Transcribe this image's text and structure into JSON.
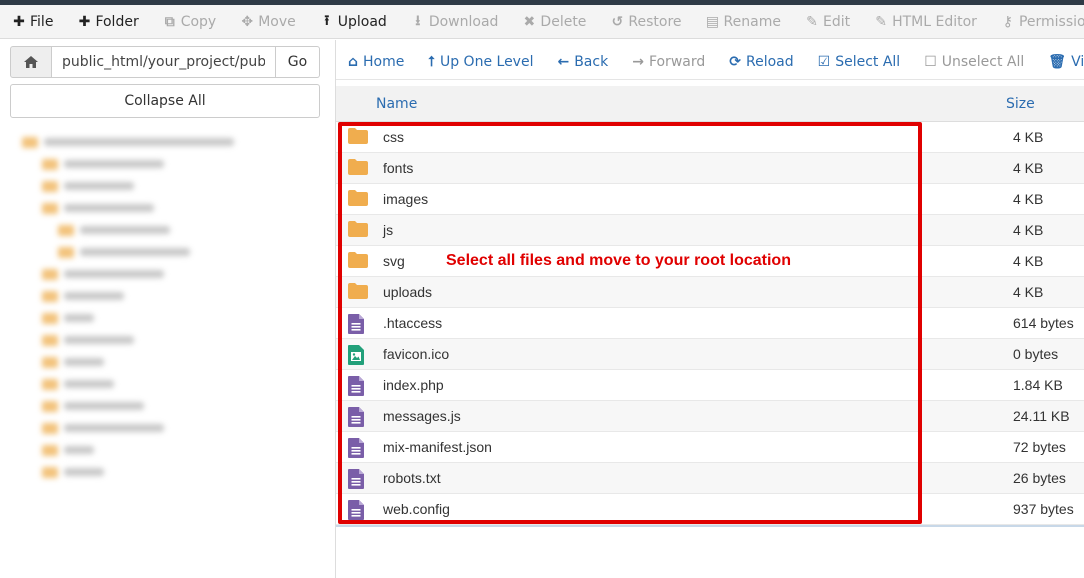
{
  "toolbar": {
    "items": [
      {
        "icon": "plus-icon",
        "glyph": "✚",
        "label": "File",
        "active": true
      },
      {
        "icon": "plus-icon",
        "glyph": "✚",
        "label": "Folder",
        "active": true
      },
      {
        "icon": "copy-icon",
        "glyph": "⧉",
        "label": "Copy",
        "active": false
      },
      {
        "icon": "move-icon",
        "glyph": "✥",
        "label": "Move",
        "active": false
      },
      {
        "icon": "upload-icon",
        "glyph": "⭱",
        "label": "Upload",
        "active": true
      },
      {
        "icon": "download-icon",
        "glyph": "⭳",
        "label": "Download",
        "active": false
      },
      {
        "icon": "close-icon",
        "glyph": "✖",
        "label": "Delete",
        "active": false
      },
      {
        "icon": "restore-icon",
        "glyph": "↺",
        "label": "Restore",
        "active": false
      },
      {
        "icon": "file-icon",
        "glyph": "▤",
        "label": "Rename",
        "active": false
      },
      {
        "icon": "pencil-icon",
        "glyph": "✎",
        "label": "Edit",
        "active": false
      },
      {
        "icon": "html-editor-icon",
        "glyph": "✎",
        "label": "HTML Editor",
        "active": false
      },
      {
        "icon": "key-icon",
        "glyph": "⚷",
        "label": "Permissions",
        "active": false
      }
    ]
  },
  "addressbar": {
    "path": "public_html/your_project/public",
    "go_label": "Go",
    "collapse_label": "Collapse All"
  },
  "nav": {
    "items": [
      {
        "icon": "home-icon",
        "glyph": "⌂",
        "label": "Home",
        "disabled": false
      },
      {
        "icon": "up-level-icon",
        "glyph": "⭡",
        "label": "Up One Level",
        "disabled": false
      },
      {
        "icon": "back-arrow-icon",
        "glyph": "←",
        "label": "Back",
        "disabled": false
      },
      {
        "icon": "forward-arrow-icon",
        "glyph": "→",
        "label": "Forward",
        "disabled": true
      },
      {
        "icon": "reload-icon",
        "glyph": "⟳",
        "label": "Reload",
        "disabled": false
      },
      {
        "icon": "checkbox-checked-icon",
        "glyph": "☑",
        "label": "Select All",
        "disabled": false
      },
      {
        "icon": "checkbox-empty-icon",
        "glyph": "☐",
        "label": "Unselect All",
        "disabled": true
      },
      {
        "icon": "trash-icon",
        "glyph": "🗑",
        "label": "View",
        "disabled": false
      }
    ]
  },
  "table": {
    "col_name": "Name",
    "col_size": "Size"
  },
  "files": [
    {
      "name": "css",
      "size": "4 KB",
      "kind": "folder"
    },
    {
      "name": "fonts",
      "size": "4 KB",
      "kind": "folder"
    },
    {
      "name": "images",
      "size": "4 KB",
      "kind": "folder"
    },
    {
      "name": "js",
      "size": "4 KB",
      "kind": "folder"
    },
    {
      "name": "svg",
      "size": "4 KB",
      "kind": "folder"
    },
    {
      "name": "uploads",
      "size": "4 KB",
      "kind": "folder"
    },
    {
      "name": ".htaccess",
      "size": "614 bytes",
      "kind": "text"
    },
    {
      "name": "favicon.ico",
      "size": "0 bytes",
      "kind": "image"
    },
    {
      "name": "index.php",
      "size": "1.84 KB",
      "kind": "text"
    },
    {
      "name": "messages.js",
      "size": "24.11 KB",
      "kind": "text"
    },
    {
      "name": "mix-manifest.json",
      "size": "72 bytes",
      "kind": "text"
    },
    {
      "name": "robots.txt",
      "size": "26 bytes",
      "kind": "text"
    },
    {
      "name": "web.config",
      "size": "937 bytes",
      "kind": "text"
    }
  ],
  "annotation": "Select all files and move to your root location",
  "colors": {
    "folder": "#f0ad4e",
    "text_file": "#7a5ea8",
    "image_file": "#22a07a",
    "link": "#2b6cb0",
    "annotation_red": "#e00000"
  }
}
